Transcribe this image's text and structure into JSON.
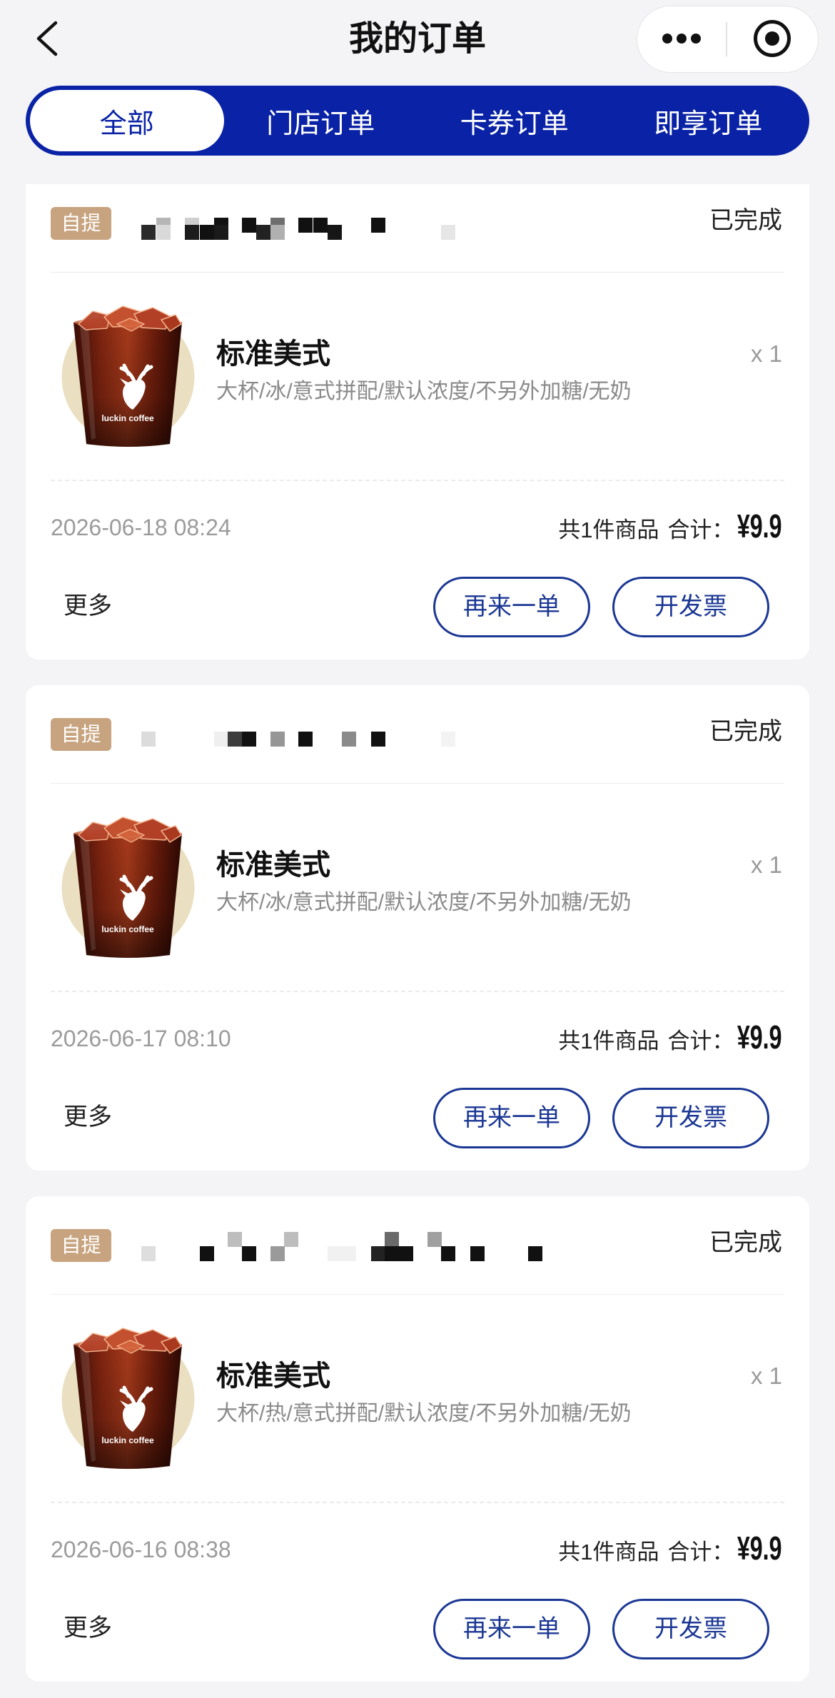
{
  "header": {
    "title": "我的订单",
    "back_icon": "chevron-left-icon",
    "menu_icon": "more-dots-icon",
    "close_icon": "target-circle-icon"
  },
  "tabs": [
    {
      "label": "全部",
      "selected": true
    },
    {
      "label": "门店订单",
      "selected": false
    },
    {
      "label": "卡券订单",
      "selected": false
    },
    {
      "label": "即享订单",
      "selected": false
    }
  ],
  "colors": {
    "brand_blue": "#0a23a6",
    "tag_tan": "#c7a47f",
    "page_bg": "#f4f4f6",
    "button_blue": "#1b3794"
  },
  "orders": [
    {
      "tag": "自提",
      "status": "已完成",
      "item": {
        "name": "标准美式",
        "quantity": "x 1",
        "spec": "大杯/冰/意式拼配/默认浓度/不另外加糖/无奶",
        "image": "iced-americano-cup-image",
        "logo_text": "luckin coffee"
      },
      "time": "2026-06-18 08:24",
      "count": "共1件商品",
      "total_label": "合计：",
      "total": "¥9.9",
      "more": "更多",
      "reorder": "再来一单",
      "invoice": "开发票"
    },
    {
      "tag": "自提",
      "status": "已完成",
      "item": {
        "name": "标准美式",
        "quantity": "x 1",
        "spec": "大杯/冰/意式拼配/默认浓度/不另外加糖/无奶",
        "image": "iced-americano-cup-image",
        "logo_text": "luckin coffee"
      },
      "time": "2026-06-17 08:10",
      "count": "共1件商品",
      "total_label": "合计：",
      "total": "¥9.9",
      "more": "更多",
      "reorder": "再来一单",
      "invoice": "开发票"
    },
    {
      "tag": "自提",
      "status": "已完成",
      "item": {
        "name": "标准美式",
        "quantity": "x 1",
        "spec": "大杯/热/意式拼配/默认浓度/不另外加糖/无奶",
        "image": "iced-americano-cup-image",
        "logo_text": "luckin coffee"
      },
      "time": "2026-06-16 08:38",
      "count": "共1件商品",
      "total_label": "合计：",
      "total": "¥9.9",
      "more": "更多",
      "reorder": "再来一单",
      "invoice": "开发票"
    }
  ]
}
